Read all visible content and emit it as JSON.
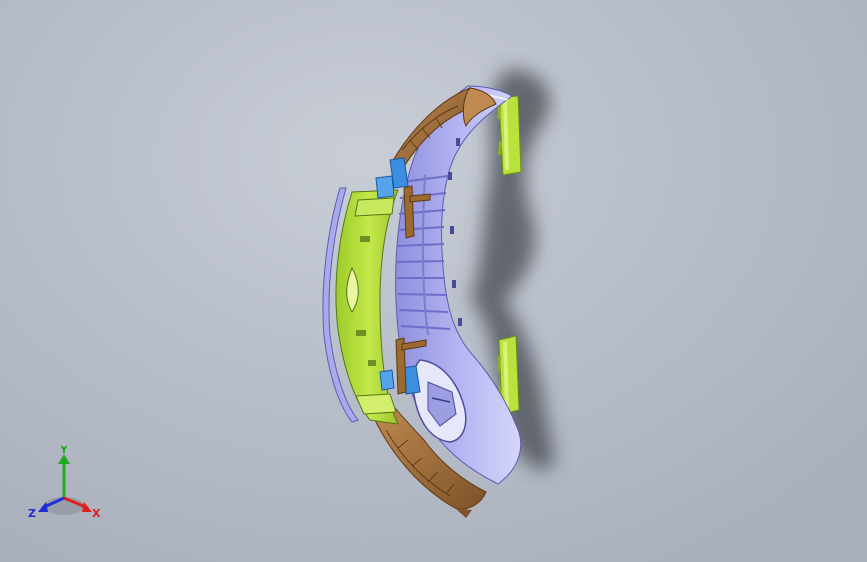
{
  "viewport": {
    "background": "#b9bfca",
    "part_colors": {
      "bumper_shell": "#b4b4f2",
      "bumper_shade": "#8f8fde",
      "outer_skin": "#a87745",
      "outer_skin_dark": "#7d5228",
      "reinforcement": "#b8e23c",
      "reinforcement_light": "#dff07a",
      "brackets": "#3c8fe0",
      "grille_ribs": "#9b9be6"
    }
  },
  "triad": {
    "x_label": "X",
    "y_label": "Y",
    "z_label": "Z",
    "x_color": "#e02020",
    "y_color": "#22aa22",
    "z_color": "#2030d8"
  }
}
